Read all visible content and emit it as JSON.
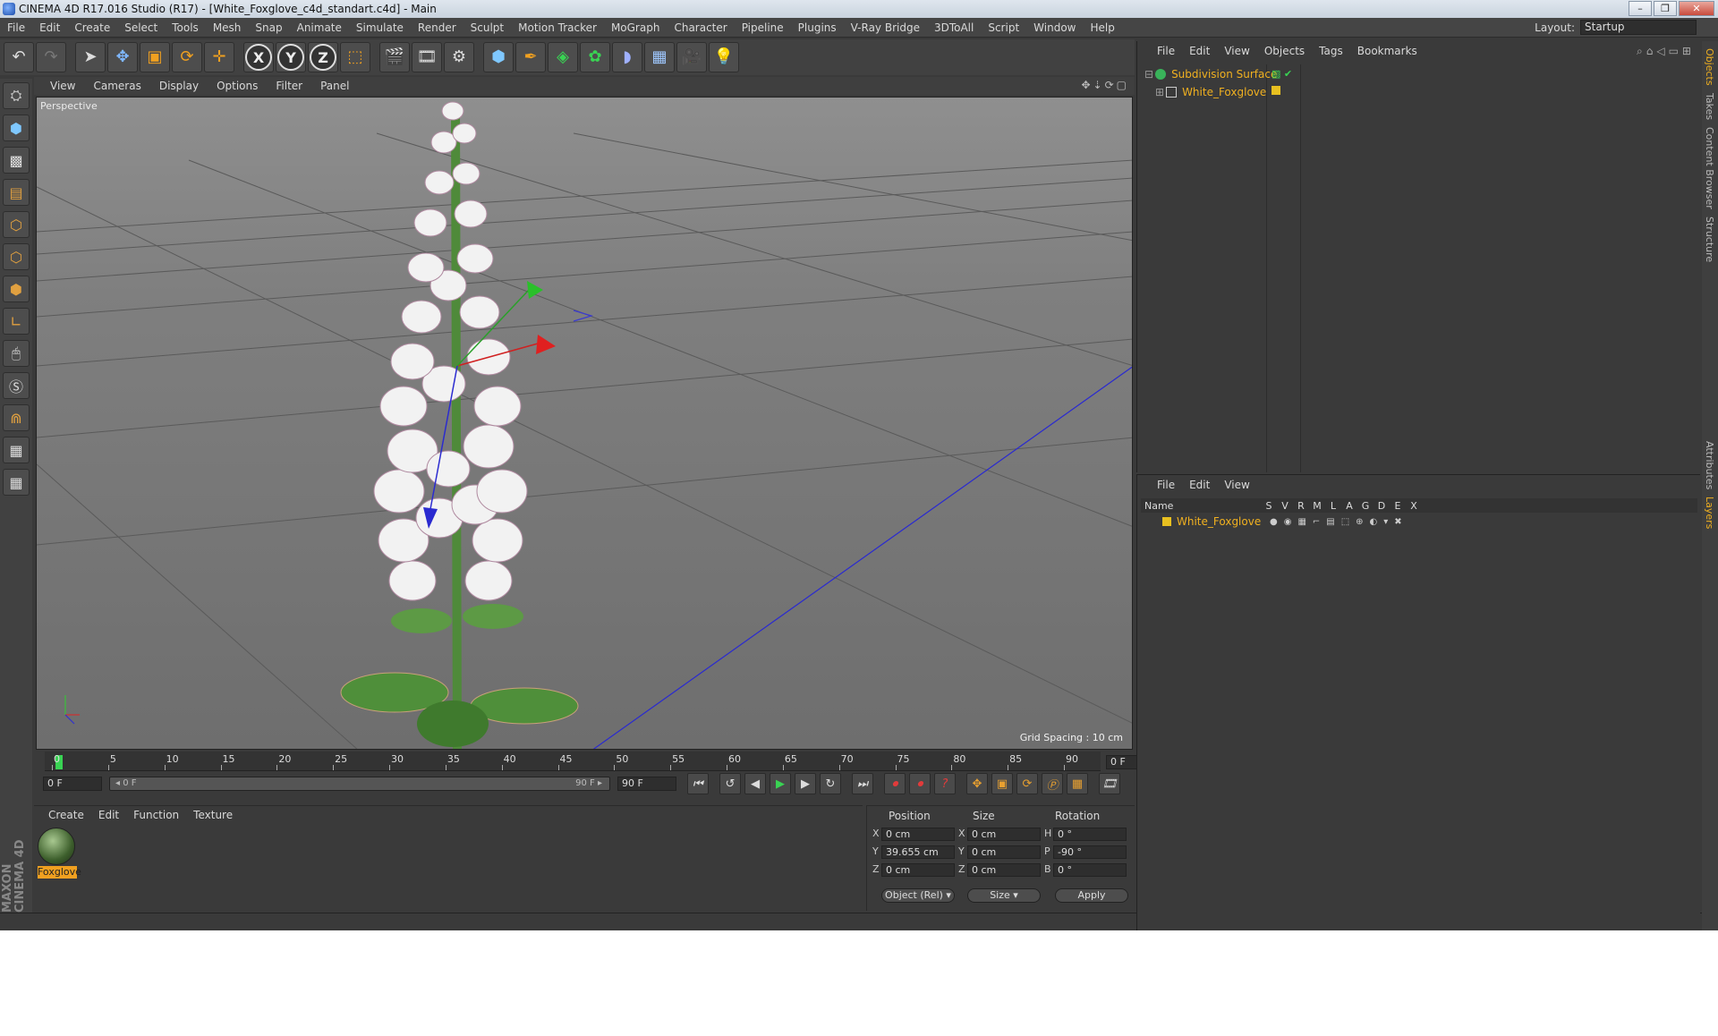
{
  "window": {
    "title": "CINEMA 4D R17.016 Studio (R17) - [White_Foxglove_c4d_standart.c4d] - Main",
    "controls": [
      "–",
      "❐",
      "✕"
    ]
  },
  "menubar": {
    "items": [
      "File",
      "Edit",
      "Create",
      "Select",
      "Tools",
      "Mesh",
      "Snap",
      "Animate",
      "Simulate",
      "Render",
      "Sculpt",
      "Motion Tracker",
      "MoGraph",
      "Character",
      "Pipeline",
      "Plugins",
      "V-Ray Bridge",
      "3DToAll",
      "Script",
      "Window",
      "Help"
    ],
    "layout_label": "Layout:",
    "layout_value": "Startup"
  },
  "viewport": {
    "menu": [
      "View",
      "Cameras",
      "Display",
      "Options",
      "Filter",
      "Panel"
    ],
    "label": "Perspective",
    "grid_spacing": "Grid Spacing : 10 cm"
  },
  "timeline": {
    "ticks": [
      "0",
      "5",
      "10",
      "15",
      "20",
      "25",
      "30",
      "35",
      "40",
      "45",
      "50",
      "55",
      "60",
      "65",
      "70",
      "75",
      "80",
      "85",
      "90"
    ],
    "current_frame": "0 F",
    "start_field": "0 F",
    "range_start": "◂ 0 F",
    "range_end": "90 F ▸",
    "end_field": "90 F",
    "end_frame_box": "0 F"
  },
  "material_manager": {
    "menu": [
      "Create",
      "Edit",
      "Function",
      "Texture"
    ],
    "material_name": "Foxglove"
  },
  "coordinates": {
    "headers": {
      "position": "Position",
      "size": "Size",
      "rotation": "Rotation"
    },
    "rows": [
      {
        "axis": "X",
        "pos": "0 cm",
        "size_axis": "X",
        "size": "0 cm",
        "rot_axis": "H",
        "rot": "0 °"
      },
      {
        "axis": "Y",
        "pos": "39.655 cm",
        "size_axis": "Y",
        "size": "0 cm",
        "rot_axis": "P",
        "rot": "-90 °"
      },
      {
        "axis": "Z",
        "pos": "0 cm",
        "size_axis": "Z",
        "size": "0 cm",
        "rot_axis": "B",
        "rot": "0 °"
      }
    ],
    "mode_select": "Object (Rel) ▾",
    "size_select": "Size ▾",
    "apply": "Apply"
  },
  "object_manager": {
    "menu": [
      "File",
      "Edit",
      "View",
      "Objects",
      "Tags",
      "Bookmarks"
    ],
    "objects": [
      "Subdivision Surface",
      "White_Foxglove"
    ]
  },
  "layer_manager": {
    "menu": [
      "File",
      "Edit",
      "View"
    ],
    "name_header": "Name",
    "flags": [
      "S",
      "V",
      "R",
      "M",
      "L",
      "A",
      "G",
      "D",
      "E",
      "X"
    ],
    "layer_name": "White_Foxglove"
  },
  "side_tabs": [
    "Objects",
    "Takes",
    "Content Browser",
    "Structure",
    "Attributes",
    "Layers"
  ],
  "maxon": "MAXON CINEMA 4D",
  "colors": {
    "accent_orange": "#f0a020",
    "object_name": "#f0b020",
    "play_green": "#39d353",
    "record_red": "#e23b3b"
  }
}
